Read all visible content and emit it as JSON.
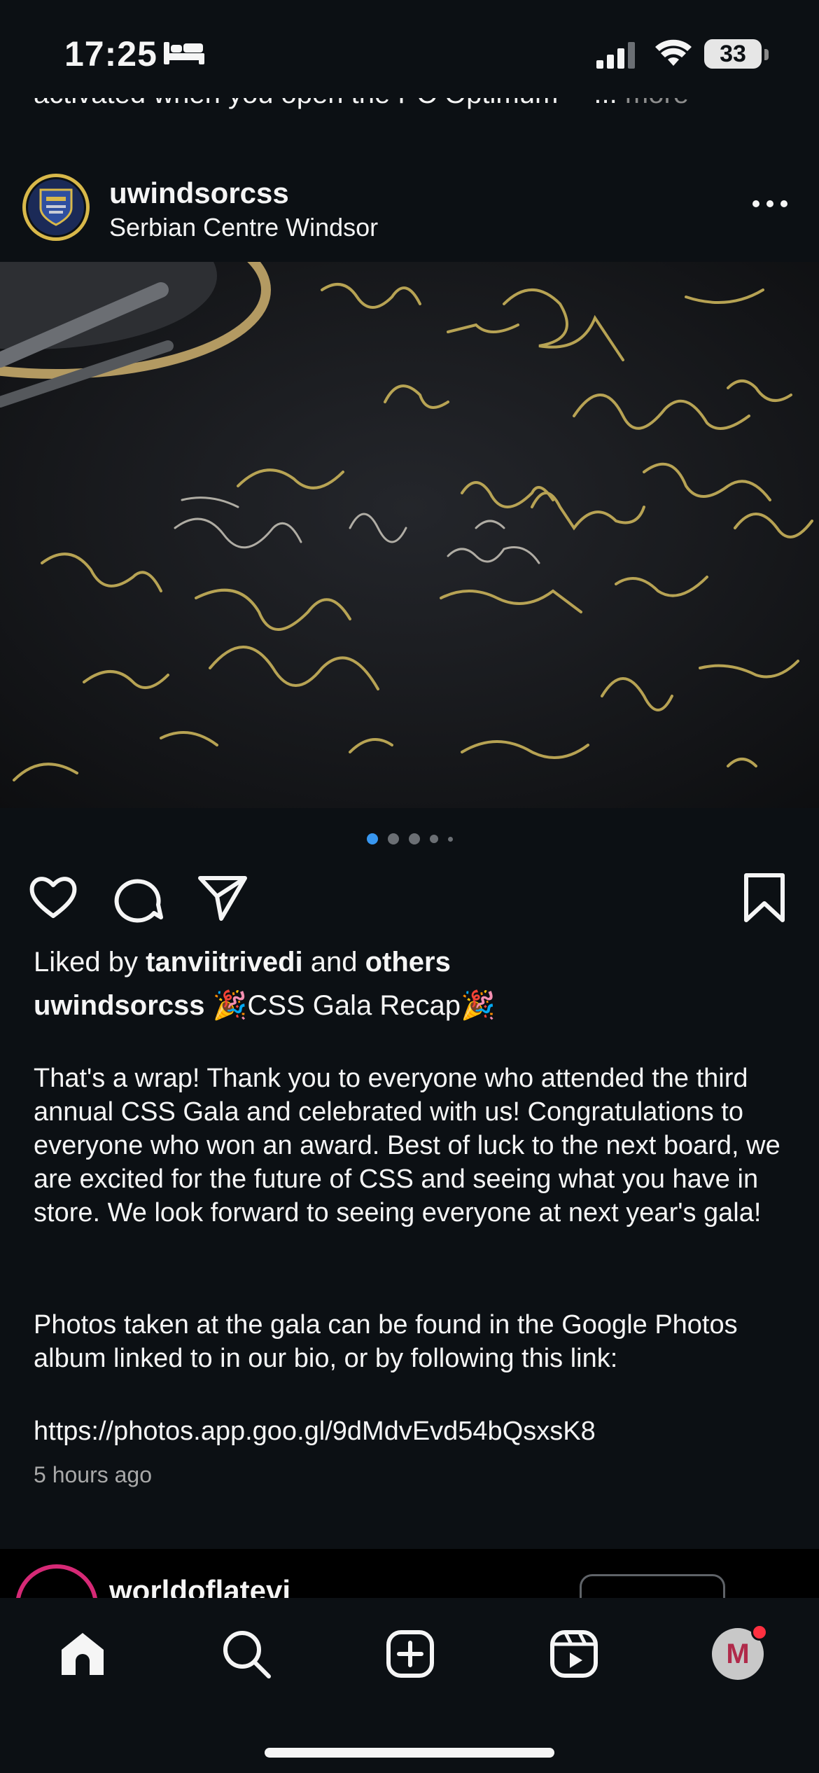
{
  "status_bar": {
    "time": "17:25",
    "battery": "33",
    "icons": [
      "bed-icon",
      "signal-icon",
      "wifi-icon",
      "battery-icon"
    ]
  },
  "previous_post": {
    "caption_tail": "activated when you open the PC Optimum™ ...",
    "more_label": "more"
  },
  "post": {
    "username": "uwindsorcss",
    "location": "Serbian Centre Windsor",
    "image_description_icon": "signed-tablecloth-photo",
    "carousel": {
      "count": 5,
      "active_index": 0
    },
    "liked_by": {
      "prefix": "Liked by ",
      "user": "tanviitrivedi",
      "middle": " and ",
      "others": "others"
    },
    "caption": {
      "username": "uwindsorcss",
      "title": " 🎉CSS Gala Recap🎉",
      "paragraph1": "That's a wrap! Thank you to everyone who attended the third annual CSS Gala and celebrated with us! Congratulations to everyone who won an award. Best of luck to the next board, we are excited for the future of CSS and seeing what you have in store. We look forward to seeing everyone at next year's gala!",
      "paragraph2": "Photos taken at the gala can be found in the Google Photos album linked to in our bio, or by following this link:",
      "link": "https://photos.app.goo.gl/9dMdvEvd54bQsxsK8"
    },
    "time_ago": "5 hours ago"
  },
  "next_post": {
    "username": "worldoflatevi"
  },
  "tab_bar": {
    "items": [
      "home-icon",
      "search-icon",
      "create-icon",
      "reels-icon",
      "profile-avatar"
    ],
    "profile_initial": "M"
  },
  "colors": {
    "background": "#0c1014",
    "text": "#f5f5f5",
    "muted": "#a8a8a8",
    "active_dot": "#3897f0",
    "notification": "#ff3040",
    "avatar_ring": "#d8b84a"
  }
}
